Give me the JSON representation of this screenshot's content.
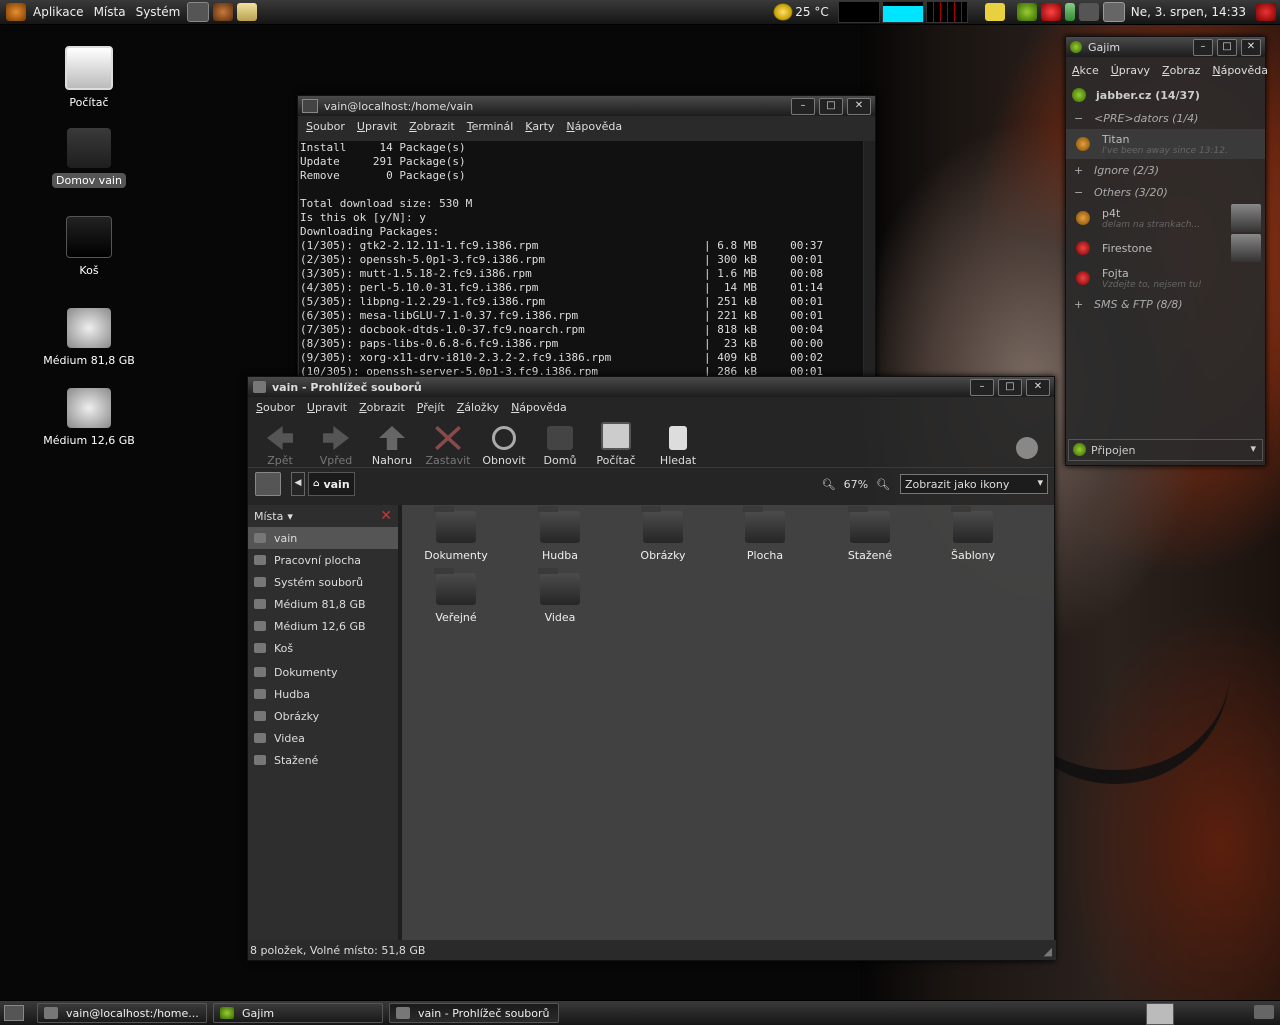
{
  "top_panel": {
    "menus": [
      "Aplikace",
      "Místa",
      "Systém"
    ],
    "weather": "25 °C",
    "clock": "Ne,  3. srpen, 14:33"
  },
  "desktop_icons": [
    {
      "label": "Počítač",
      "icon": "computer-icon"
    },
    {
      "label": "Domov vain",
      "icon": "home-folder-icon"
    },
    {
      "label": "Koš",
      "icon": "trash-icon"
    },
    {
      "label": "Médium 81,8 GB",
      "icon": "harddisk-icon"
    },
    {
      "label": "Médium 12,6 GB",
      "icon": "harddisk-icon"
    }
  ],
  "terminal": {
    "title": "vain@localhost:/home/vain",
    "menu": [
      "Soubor",
      "Upravit",
      "Zobrazit",
      "Terminál",
      "Karty",
      "Nápověda"
    ],
    "lines": [
      "Install     14 Package(s)",
      "Update     291 Package(s)",
      "Remove       0 Package(s)",
      "",
      "Total download size: 530 M",
      "Is this ok [y/N]: y",
      "Downloading Packages:",
      "(1/305): gtk2-2.12.11-1.fc9.i386.rpm                         | 6.8 MB     00:37",
      "(2/305): openssh-5.0p1-3.fc9.i386.rpm                        | 300 kB     00:01",
      "(3/305): mutt-1.5.18-2.fc9.i386.rpm                          | 1.6 MB     00:08",
      "(4/305): perl-5.10.0-31.fc9.i386.rpm                         |  14 MB     01:14",
      "(5/305): libpng-1.2.29-1.fc9.i386.rpm                        | 251 kB     00:01",
      "(6/305): mesa-libGLU-7.1-0.37.fc9.i386.rpm                   | 221 kB     00:01",
      "(7/305): docbook-dtds-1.0-37.fc9.noarch.rpm                  | 818 kB     00:04",
      "(8/305): paps-libs-0.6.8-6.fc9.i386.rpm                      |  23 kB     00:00",
      "(9/305): xorg-x11-drv-i810-2.3.2-2.fc9.i386.rpm              | 409 kB     00:02",
      "(10/305): openssh-server-5.0p1-3.fc9.i386.rpm                | 286 kB     00:01"
    ]
  },
  "nautilus": {
    "title": "vain - Prohlížeč souborů",
    "menu": [
      "Soubor",
      "Upravit",
      "Zobrazit",
      "Přejít",
      "Záložky",
      "Nápověda"
    ],
    "toolbar": [
      "Zpět",
      "Vpřed",
      "Nahoru",
      "Zastavit",
      "Obnovit",
      "Domů",
      "Počítač",
      "Hledat"
    ],
    "path": "vain",
    "zoom": "67%",
    "view_mode": "Zobrazit jako ikony",
    "sidebar_header": "Místa",
    "sidebar": [
      "vain",
      "Pracovní plocha",
      "Systém souborů",
      "Médium 81,8 GB",
      "Médium 12,6 GB",
      "Koš",
      "Dokumenty",
      "Hudba",
      "Obrázky",
      "Videa",
      "Stažené"
    ],
    "folders": [
      "Dokumenty",
      "Hudba",
      "Obrázky",
      "Plocha",
      "Stažené",
      "Šablony",
      "Veřejné",
      "Videa"
    ],
    "status": "8 položek, Volné místo: 51,8 GB"
  },
  "gajim": {
    "title": "Gajim",
    "menu": [
      "Akce",
      "Úpravy",
      "Zobraz",
      "Nápověda"
    ],
    "account": "jabber.cz (14/37)",
    "groups": [
      {
        "label": "<PRE>dators (1/4)",
        "sign": "−"
      },
      {
        "label": "Ignore (2/3)",
        "sign": "+"
      },
      {
        "label": "Others (3/20)",
        "sign": "−"
      },
      {
        "label": "SMS & FTP (8/8)",
        "sign": "+"
      }
    ],
    "contacts": [
      {
        "name": "Titan",
        "status": "I've been away since 13:12."
      },
      {
        "name": "p4t",
        "status": "delam na strankach..."
      },
      {
        "name": "Firestone",
        "status": ""
      },
      {
        "name": "Fojta",
        "status": "Vzdejte to, nejsem tu!"
      }
    ],
    "presence": "Připojen"
  },
  "taskbar": [
    {
      "label": "vain@localhost:/home..."
    },
    {
      "label": "Gajim"
    },
    {
      "label": "vain - Prohlížeč souborů"
    }
  ]
}
